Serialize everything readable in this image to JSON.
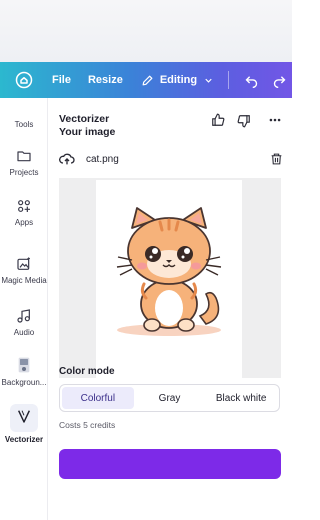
{
  "toolbar": {
    "file_label": "File",
    "resize_label": "Resize",
    "editing_label": "Editing"
  },
  "sidebar": {
    "items": [
      {
        "label": "Tools",
        "icon": "tools-icon"
      },
      {
        "label": "Projects",
        "icon": "folder-icon"
      },
      {
        "label": "Apps",
        "icon": "apps-icon"
      },
      {
        "label": "Magic Media",
        "icon": "magic-media-icon"
      },
      {
        "label": "Audio",
        "icon": "music-note-icon"
      },
      {
        "label": "Backgroun...",
        "icon": "background-remover-icon"
      },
      {
        "label": "Vectorizer",
        "icon": "vectorizer-icon"
      }
    ]
  },
  "panel": {
    "title": "Vectorizer",
    "subtitle": "Your image",
    "file_name": "cat.png",
    "color_mode_label": "Color mode",
    "color_mode_options": [
      "Colorful",
      "Gray",
      "Black white"
    ],
    "selected_mode": "Colorful",
    "credits_text": "Costs 5 credits"
  },
  "colors": {
    "accent": "#7d2ae8",
    "toolbar_start": "#2cb8cf",
    "toolbar_end": "#7256e6"
  }
}
